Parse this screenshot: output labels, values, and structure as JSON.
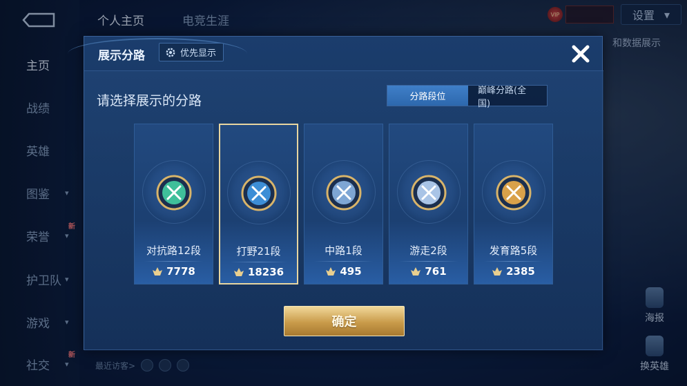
{
  "header": {
    "tabs": [
      {
        "label": "个人主页",
        "active": true
      },
      {
        "label": "电竞生涯",
        "active": false
      }
    ],
    "settings_label": "设置",
    "vip_label": "VIP"
  },
  "sidebar": {
    "items": [
      {
        "label": "主页",
        "active": true,
        "chevron": false,
        "new": false
      },
      {
        "label": "战绩",
        "active": false,
        "chevron": false,
        "new": false
      },
      {
        "label": "英雄",
        "active": false,
        "chevron": false,
        "new": false
      },
      {
        "label": "图鉴",
        "active": false,
        "chevron": true,
        "new": false
      },
      {
        "label": "荣誉",
        "active": false,
        "chevron": true,
        "new": true
      },
      {
        "label": "护卫队",
        "active": false,
        "chevron": true,
        "new": false
      },
      {
        "label": "游戏",
        "active": false,
        "chevron": true,
        "new": false
      },
      {
        "label": "社交",
        "active": false,
        "chevron": true,
        "new": true
      }
    ],
    "new_badge": "新"
  },
  "background": {
    "right_text": "和数据展示",
    "report_label": "海报",
    "switch_hero_label": "换英雄",
    "recent_visitors_label": "最近访客>"
  },
  "modal": {
    "title": "展示分路",
    "priority_label": "优先显示",
    "prompt": "请选择展示的分路",
    "segments": [
      {
        "label": "分路段位",
        "active": true
      },
      {
        "label": "巅峰分路(全国)",
        "active": false
      }
    ],
    "cards": [
      {
        "rank": "对抗路12段",
        "score": "7778",
        "emblem": "clash-lane-emblem-icon",
        "color": "#3fbf9a",
        "selected": false
      },
      {
        "rank": "打野21段",
        "score": "18236",
        "emblem": "jungle-dragon-emblem-icon",
        "color": "#3d8ed6",
        "selected": true
      },
      {
        "rank": "中路1段",
        "score": "495",
        "emblem": "mid-lane-emblem-icon",
        "color": "#7ea6d4",
        "selected": false
      },
      {
        "rank": "游走2段",
        "score": "761",
        "emblem": "roam-wings-emblem-icon",
        "color": "#a9c4e6",
        "selected": false
      },
      {
        "rank": "发育路5段",
        "score": "2385",
        "emblem": "farm-lane-emblem-icon",
        "color": "#d9a14a",
        "selected": false
      }
    ],
    "confirm_label": "确定"
  },
  "colors": {
    "accent_blue": "#3f7fc8",
    "gold": "#c99b4a",
    "selected_border": "#e8d6a0"
  }
}
